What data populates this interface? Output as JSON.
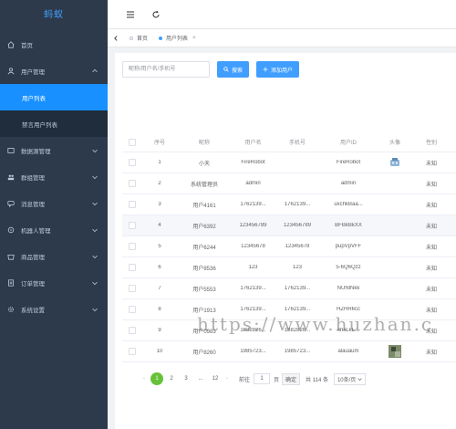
{
  "app": {
    "logo": "蚂蚁"
  },
  "sidebar": {
    "items": [
      {
        "label": "首页",
        "icon": "home-icon"
      },
      {
        "label": "用户管理",
        "icon": "user-icon"
      },
      {
        "label": "数据源管理",
        "icon": "database-icon"
      },
      {
        "label": "群组管理",
        "icon": "group-icon"
      },
      {
        "label": "消息管理",
        "icon": "message-icon"
      },
      {
        "label": "机器人管理",
        "icon": "robot-icon"
      },
      {
        "label": "商品管理",
        "icon": "goods-icon"
      },
      {
        "label": "订单管理",
        "icon": "order-icon"
      },
      {
        "label": "系统设置",
        "icon": "settings-icon"
      }
    ],
    "submenu": [
      {
        "label": "用户列表"
      },
      {
        "label": "禁言用户列表"
      }
    ]
  },
  "topbar": {
    "menu_icon": "hamburger-icon",
    "refresh_icon": "refresh-icon"
  },
  "tags": [
    {
      "label": "首页",
      "dot_color": "#dcdfe6"
    },
    {
      "label": "用户列表",
      "dot_color": "#409eff",
      "close": "×"
    }
  ],
  "search": {
    "placeholder": "昵称/用户名/手机号",
    "search_label": "搜索",
    "add_label": "添加用户"
  },
  "table": {
    "columns": [
      "序号",
      "昵称",
      "用户名",
      "手机号",
      "用户ID",
      "头像",
      "性别"
    ],
    "rows": [
      {
        "idx": "1",
        "nick": "小天",
        "user": "FireRobot",
        "phone": "",
        "uid": "FireRobot",
        "status": "未知"
      },
      {
        "idx": "2",
        "nick": "系统管理员",
        "user": "admin",
        "phone": "",
        "uid": "admin",
        "status": "未知"
      },
      {
        "idx": "3",
        "nick": "用户4161",
        "user": "1762139...",
        "phone": "1762139...",
        "uid": "uxchkBaa...",
        "status": "未知"
      },
      {
        "idx": "4",
        "nick": "用户6392",
        "user": "123456789",
        "phone": "123456789",
        "uid": "BFBkBkXX",
        "status": "未知"
      },
      {
        "idx": "5",
        "nick": "用户6244",
        "user": "12345678",
        "phone": "12345678",
        "uid": "pupVpVFF",
        "status": "未知"
      },
      {
        "idx": "6",
        "nick": "用户8536",
        "user": "123",
        "phone": "123",
        "uid": "5-6Q6Qzz",
        "status": "未知"
      },
      {
        "idx": "7",
        "nick": "用户5553",
        "user": "1762139...",
        "phone": "1762139...",
        "uid": "NUNlNkk",
        "status": "未知"
      },
      {
        "idx": "8",
        "nick": "用户1913",
        "user": "1762139...",
        "phone": "1762139...",
        "uid": "HZHR6cc",
        "status": "未知"
      },
      {
        "idx": "9",
        "nick": "用户0983",
        "user": "1882826...",
        "phone": "1882826...",
        "uid": "xhxLkL...",
        "status": "未知"
      },
      {
        "idx": "10",
        "nick": "用户8260",
        "user": "1985723...",
        "phone": "1985723...",
        "uid": "alauaum",
        "status": "未知"
      }
    ]
  },
  "pagination": {
    "prev": "‹",
    "pages": [
      "1",
      "2",
      "3",
      "...",
      "12"
    ],
    "next": "›",
    "goto_label": "前往",
    "goto_value": "1",
    "page_unit": "页",
    "confirm": "确定",
    "total": "共 114 条",
    "page_size": "10条/页"
  },
  "watermark": "https://www.huzhan.c"
}
